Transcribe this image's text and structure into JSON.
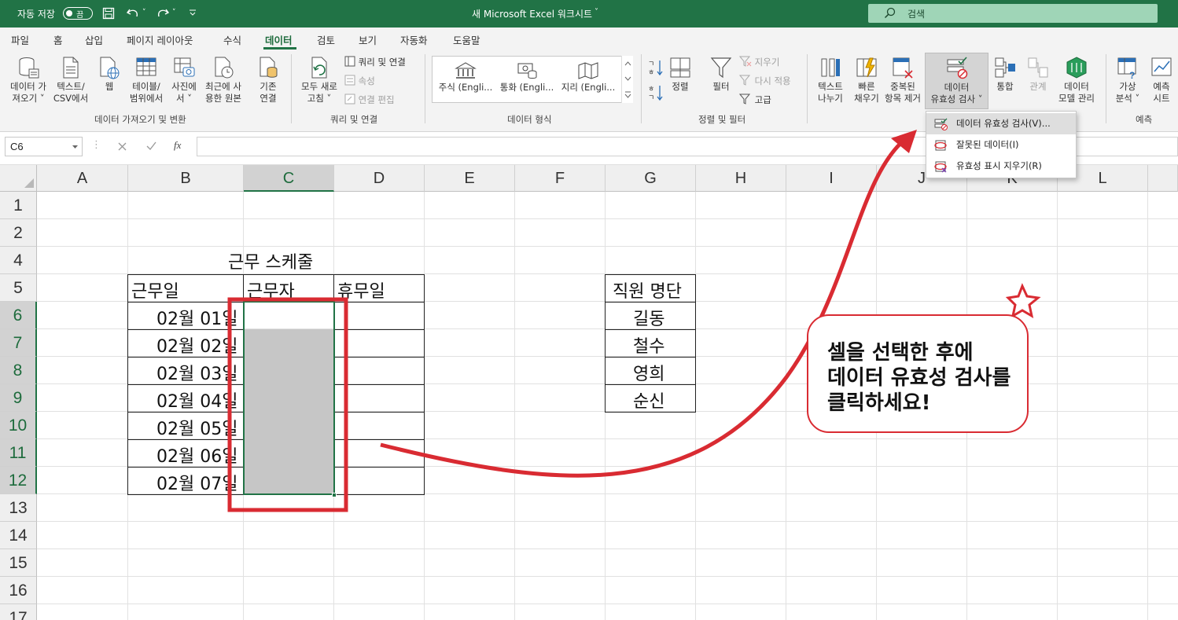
{
  "titlebar": {
    "autosave_label": "자동 저장",
    "autosave_state": "끔",
    "doc_title": "새 Microsoft Excel 워크시트",
    "search_placeholder": "검색"
  },
  "tabs": [
    "파일",
    "홈",
    "삽입",
    "페이지 레이아웃",
    "수식",
    "데이터",
    "검토",
    "보기",
    "자동화",
    "도움말"
  ],
  "active_tab": "데이터",
  "ribbon": {
    "get_data": [
      "데이터 가",
      "져오기 ˅"
    ],
    "text_csv": [
      "텍스트/",
      "CSV에서"
    ],
    "web": [
      "웹"
    ],
    "table_range": [
      "테이블/",
      "범위에서"
    ],
    "from_picture": [
      "사진에",
      "서 ˅"
    ],
    "recent_sources": [
      "최근에 사",
      "용한 원본"
    ],
    "existing_conn": [
      "기존",
      "연결"
    ],
    "group_get": "데이터 가져오기 및 변환",
    "refresh_all": [
      "모두 새로",
      "고침 ˅"
    ],
    "queries_conn": "쿼리 및 연결",
    "properties": "속성",
    "edit_links": "연결 편집",
    "group_queries": "쿼리 및 연결",
    "stocks": "주식 (Engli...",
    "currency": "통화 (Engli...",
    "geography": "지리 (Engli...",
    "group_datatypes": "데이터 형식",
    "sort": "정렬",
    "filter": "필터",
    "clear": "지우기",
    "reapply": "다시 적용",
    "advanced": "고급",
    "group_sort": "정렬 및 필터",
    "text_to_columns": [
      "텍스트",
      "나누기"
    ],
    "flash_fill": [
      "빠른",
      "채우기"
    ],
    "remove_dup": [
      "중복된",
      "항목 제거"
    ],
    "data_validation": [
      "데이터",
      "유효성 검사 ˅"
    ],
    "consolidate": "통합",
    "relationships": "관계",
    "data_model": [
      "데이터",
      "모델 관리"
    ],
    "whatif": [
      "가상",
      "분석 ˅"
    ],
    "forecast": [
      "예측",
      "시트"
    ],
    "group_forecast": "예측"
  },
  "dropdown": {
    "items": [
      "데이터 유효성 검사(V)...",
      "잘못된 데이터(I)",
      "유효성 표시 지우기(R)"
    ]
  },
  "formula_bar": {
    "name_box": "C6",
    "fx": "fx",
    "formula": ""
  },
  "columns": [
    "A",
    "B",
    "C",
    "D",
    "E",
    "F",
    "G",
    "H",
    "I",
    "J",
    "K",
    "L"
  ],
  "rows": [
    "1",
    "2",
    "4",
    "5",
    "6",
    "7",
    "8",
    "9",
    "10",
    "11",
    "12",
    "13",
    "14",
    "15",
    "16",
    "17"
  ],
  "sheet": {
    "schedule_title": "근무 스케줄",
    "headers": [
      "근무일",
      "근무자",
      "휴무일"
    ],
    "dates": [
      "02월 01일",
      "02월 02일",
      "02월 03일",
      "02월 04일",
      "02월 05일",
      "02월 06일",
      "02월 07일"
    ],
    "staff_header": "직원 명단",
    "staff": [
      "길동",
      "철수",
      "영희",
      "순신"
    ]
  },
  "callout": {
    "lines": [
      "셀을 선택한 후에",
      "데이터 유효성 검사를",
      "클릭하세요!"
    ]
  },
  "colors": {
    "excel_green": "#217346",
    "annotation_red": "#d92b32",
    "fill_gray": "#c6c6c6"
  }
}
